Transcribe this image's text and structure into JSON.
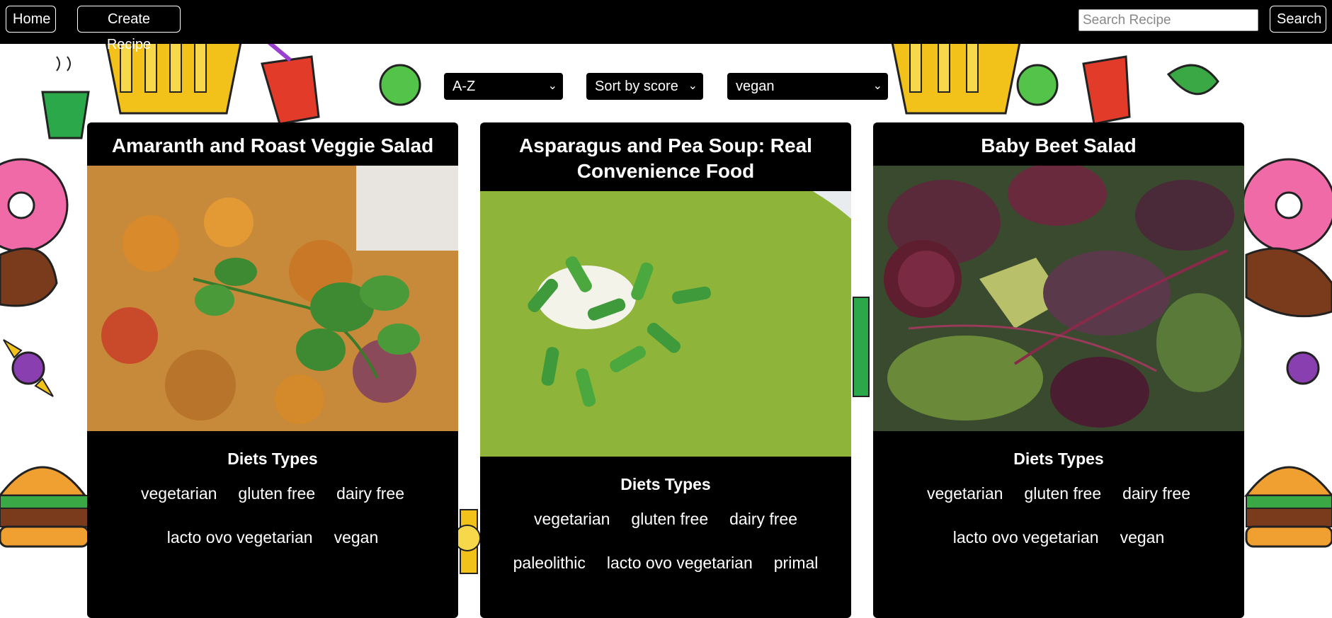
{
  "nav": {
    "home_label": "Home",
    "create_label": "Create Recipe",
    "search_placeholder": "Search Recipe",
    "search_value": "",
    "search_button_label": "Search"
  },
  "filters": {
    "order_value": "A-Z",
    "sort_value": "Sort by score",
    "diet_value": "vegan"
  },
  "diets_heading": "Diets Types",
  "recipes": [
    {
      "title": "Amaranth and Roast Veggie Salad",
      "image_subject": "roasted sweet potato with cilantro",
      "diets": [
        "vegetarian",
        "gluten free",
        "dairy free",
        "lacto ovo vegetarian",
        "vegan"
      ]
    },
    {
      "title": "Asparagus and Pea Soup: Real Convenience Food",
      "image_subject": "green pea soup with chives",
      "diets": [
        "vegetarian",
        "gluten free",
        "dairy free",
        "paleolithic",
        "lacto ovo vegetarian",
        "primal"
      ]
    },
    {
      "title": "Baby Beet Salad",
      "image_subject": "beet and avocado salad",
      "diets": [
        "vegetarian",
        "gluten free",
        "dairy free",
        "lacto ovo vegetarian",
        "vegan"
      ]
    }
  ],
  "colors": {
    "nav_bg": "#000000",
    "card_bg": "#000000",
    "text": "#ffffff"
  }
}
